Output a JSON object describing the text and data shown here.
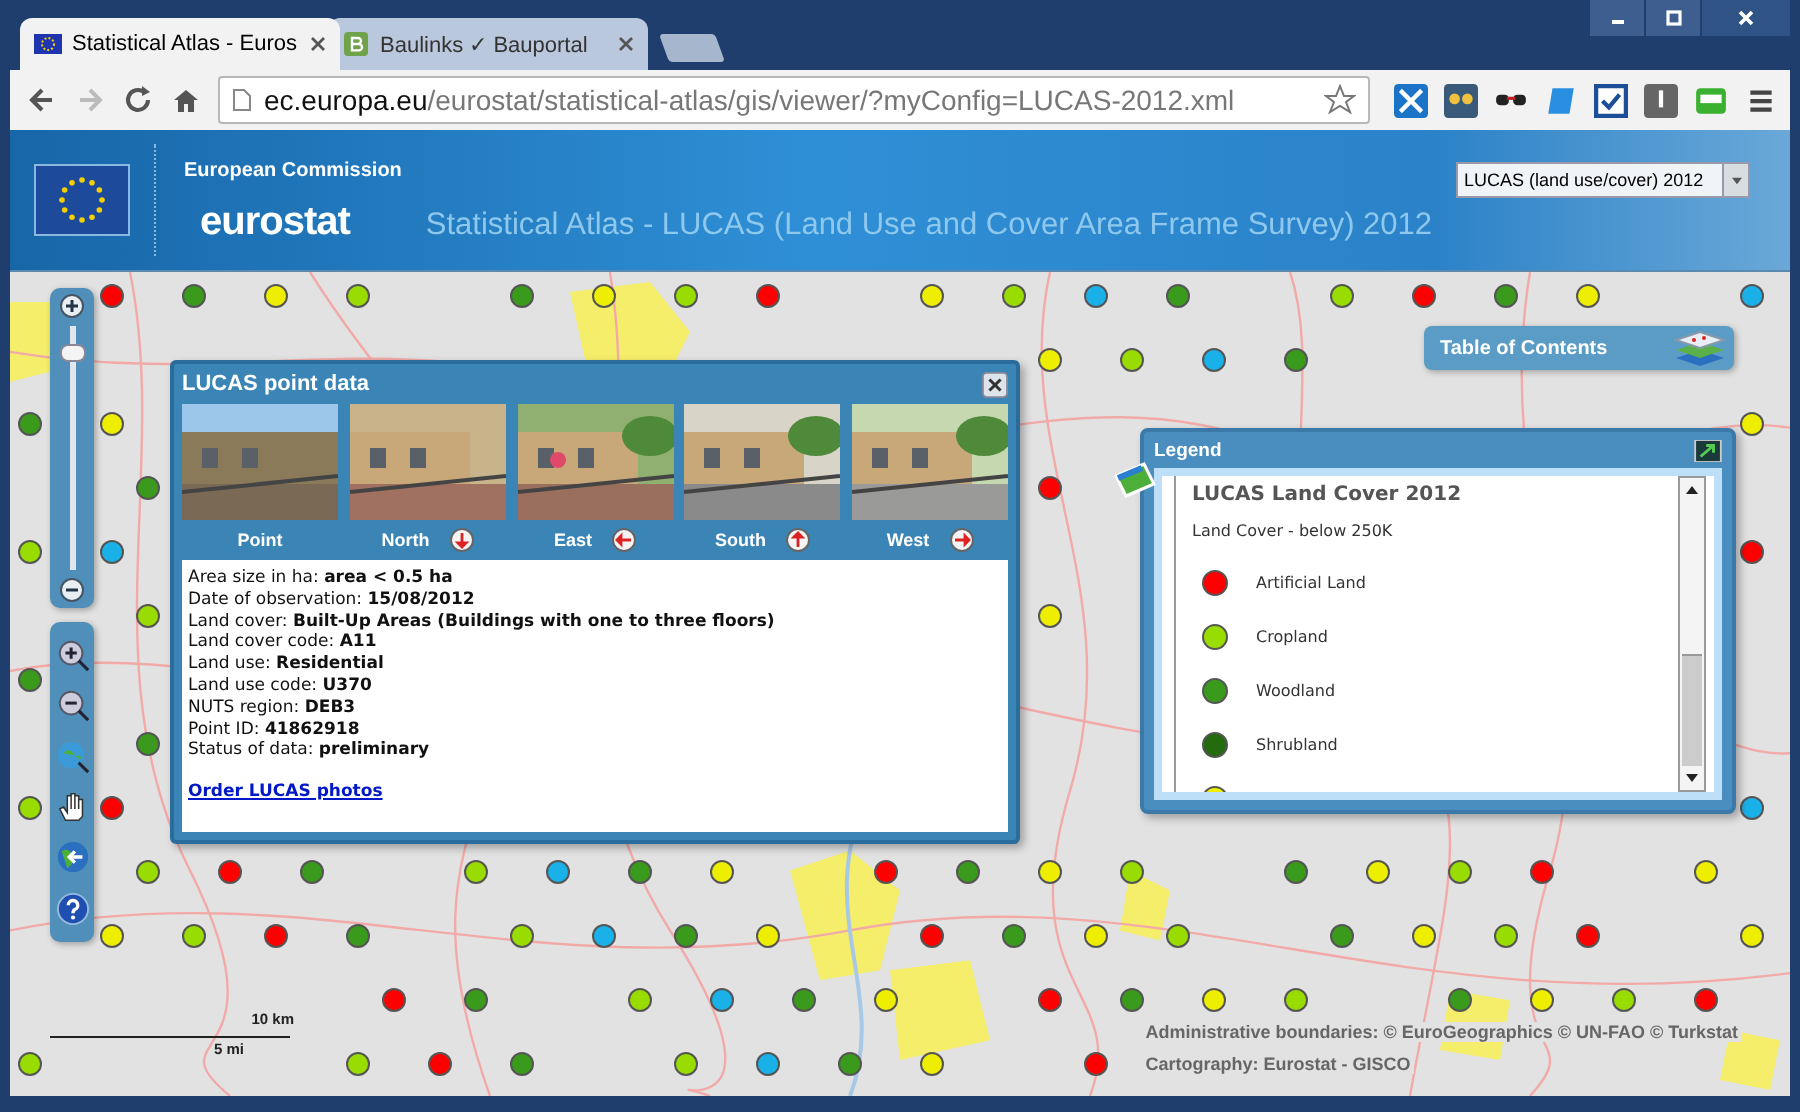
{
  "browser": {
    "tabs": [
      {
        "title": "Statistical Atlas - Euros",
        "selected": true
      },
      {
        "title": "Baulinks ✓ Bauportal",
        "selected": false
      }
    ],
    "url": {
      "host": "ec.europa.eu",
      "path": "/eurostat/statistical-atlas/gis/viewer/?myConfig=LUCAS-2012.xml"
    }
  },
  "header": {
    "organisation": "European Commission",
    "logo": "eurostat",
    "title": "Statistical Atlas - LUCAS (Land Use and Cover Area Frame Survey) 2012",
    "theme_select": "LUCAS (land use/cover) 2012"
  },
  "zoom_slider": {
    "level": 0.93
  },
  "point_popup": {
    "title": "LUCAS point data",
    "photos": [
      {
        "label": "Point",
        "kind": "point"
      },
      {
        "label": "North",
        "kind": "north"
      },
      {
        "label": "East",
        "kind": "east"
      },
      {
        "label": "South",
        "kind": "south"
      },
      {
        "label": "West",
        "kind": "west"
      }
    ],
    "fields": [
      "Area size in ha: **area < 0.5 ha**",
      "Date of observation: **15/08/2012**",
      "Land cover: **Built-Up Areas (Buildings with one to three floors)**",
      "Land cover code: **A11**",
      "Land use: **Residential**",
      "Land use code: **U370**",
      "NUTS region: **DEB3**",
      "Point ID: **41862918**",
      "Status of data: **preliminary**"
    ],
    "link": "Order LUCAS photos"
  },
  "table_of_contents": "Table of Contents",
  "legend": {
    "title": "Legend",
    "heading": "LUCAS Land Cover 2012",
    "subheading": "Land Cover - below 250K",
    "items": [
      {
        "label": "Artificial Land",
        "color": "#ff0000"
      },
      {
        "label": "Cropland",
        "color": "#99dd00"
      },
      {
        "label": "Woodland",
        "color": "#3a9a1c"
      },
      {
        "label": "Shrubland",
        "color": "#236b0e"
      },
      {
        "color": "#eeee00"
      }
    ]
  },
  "scale": {
    "metric": "10 km",
    "imperial": "5 mi"
  },
  "attribution": [
    "Administrative boundaries: © EuroGeographics © UN-FAO © Turkstat",
    "Cartography: Eurostat - GISCO"
  ]
}
